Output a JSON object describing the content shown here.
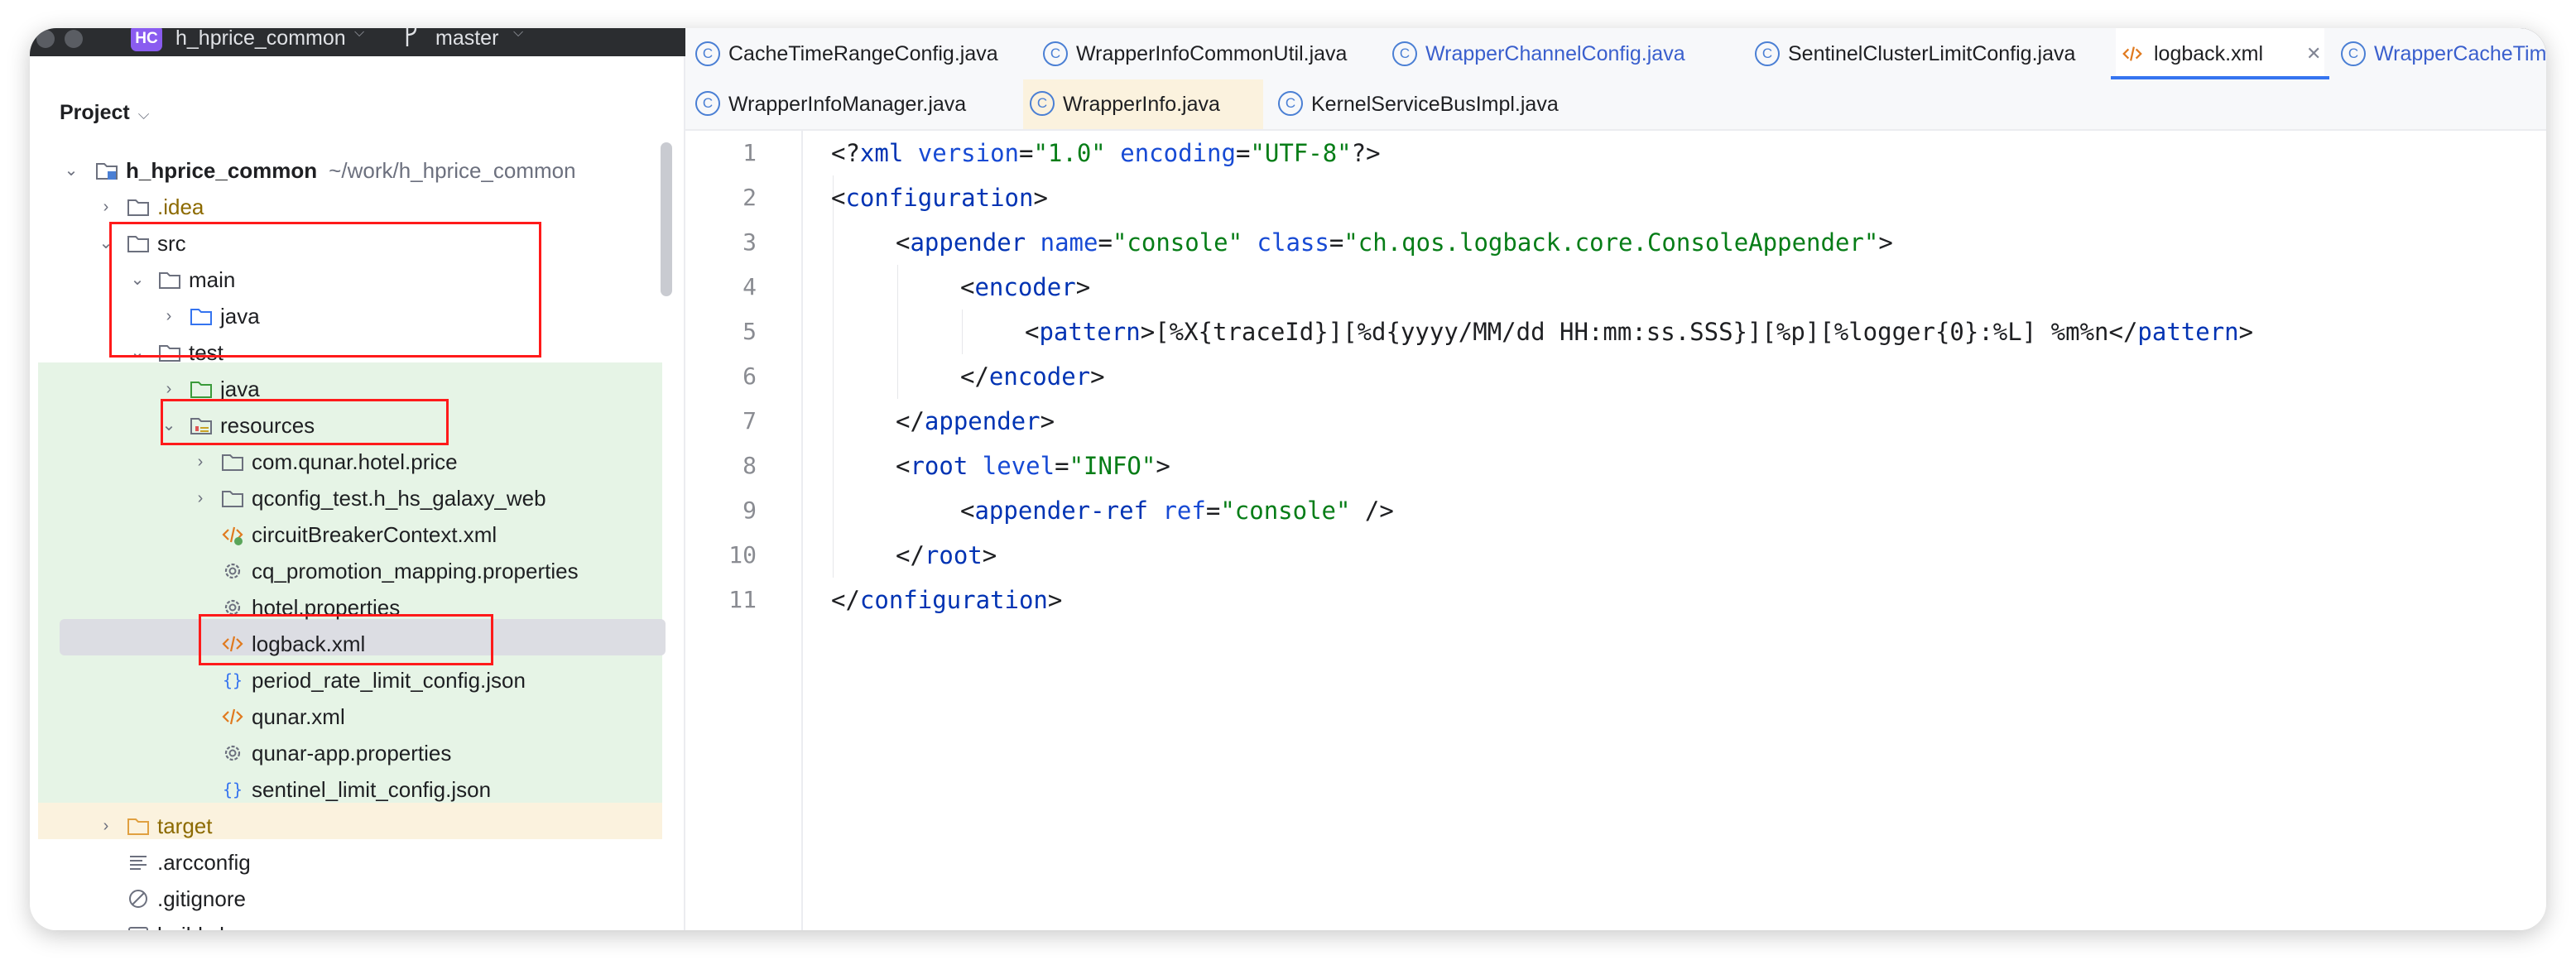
{
  "titlebar": {
    "project_badge": "HC",
    "project_name": "h_hprice_common",
    "branch": "master",
    "colors": {
      "bar": "#2b2d30",
      "badge": "#8a5cf0"
    }
  },
  "sidebar": {
    "title": "Project",
    "tree": [
      {
        "label": "h_hprice_common",
        "sub": "~/work/h_hprice_common",
        "icon": "module-folder-icon",
        "bold": true
      },
      {
        "label": ".idea",
        "icon": "folder-icon",
        "color": "#8c6a00"
      },
      {
        "label": "src",
        "icon": "folder-icon"
      },
      {
        "label": "main",
        "icon": "folder-icon"
      },
      {
        "label": "java",
        "icon": "source-folder-icon"
      },
      {
        "label": "test",
        "icon": "folder-icon"
      },
      {
        "label": "java",
        "icon": "test-folder-icon"
      },
      {
        "label": "resources",
        "icon": "resources-folder-icon"
      },
      {
        "label": "com.qunar.hotel.price",
        "icon": "package-folder-icon"
      },
      {
        "label": "qconfig_test.h_hs_galaxy_web",
        "icon": "package-folder-icon"
      },
      {
        "label": "circuitBreakerContext.xml",
        "icon": "xml-file-icon"
      },
      {
        "label": "cq_promotion_mapping.properties",
        "icon": "properties-file-icon"
      },
      {
        "label": "hotel.properties",
        "icon": "properties-file-icon"
      },
      {
        "label": "logback.xml",
        "icon": "xml-file-icon"
      },
      {
        "label": "period_rate_limit_config.json",
        "icon": "json-file-icon"
      },
      {
        "label": "qunar.xml",
        "icon": "xml-file-icon"
      },
      {
        "label": "qunar-app.properties",
        "icon": "properties-file-icon"
      },
      {
        "label": "sentinel_limit_config.json",
        "icon": "json-file-icon"
      },
      {
        "label": "target",
        "icon": "excluded-folder-icon",
        "color": "#8c6a00"
      },
      {
        "label": ".arcconfig",
        "icon": "text-file-icon"
      },
      {
        "label": ".gitignore",
        "icon": "ignore-file-icon"
      },
      {
        "label": "build.sh",
        "icon": "shell-file-icon"
      }
    ]
  },
  "tabs_row1": [
    {
      "label": "CacheTimeRangeConfig.java",
      "icon": "class-icon",
      "color": "#1e1f22"
    },
    {
      "label": "WrapperInfoCommonUtil.java",
      "icon": "class-icon",
      "color": "#1e1f22"
    },
    {
      "label": "WrapperChannelConfig.java",
      "icon": "class-icon",
      "color": "#3a5fcd"
    },
    {
      "label": "SentinelClusterLimitConfig.java",
      "icon": "class-icon",
      "color": "#1e1f22"
    },
    {
      "label": "logback.xml",
      "icon": "xml-file-icon",
      "color": "#1e1f22",
      "active": true,
      "close": "✕"
    },
    {
      "label": "WrapperCacheTimeConf",
      "icon": "class-icon",
      "color": "#3a5fcd"
    }
  ],
  "tabs_row2": [
    {
      "label": "WrapperInfoManager.java",
      "icon": "class-icon",
      "color": "#1e1f22"
    },
    {
      "label": "WrapperInfo.java",
      "icon": "class-icon",
      "color": "#1e1f22"
    },
    {
      "label": "KernelServiceBusImpl.java",
      "icon": "class-icon",
      "color": "#1e1f22"
    }
  ],
  "editor": {
    "lines": [
      "1",
      "2",
      "3",
      "4",
      "5",
      "6",
      "7",
      "8",
      "9",
      "10",
      "11"
    ],
    "code": {
      "l1": {
        "open": "<?",
        "name": "xml",
        "a1": "version",
        "v1": "\"1.0\"",
        "a2": "encoding",
        "v2": "\"UTF-8\"",
        "close": "?>"
      },
      "l2": {
        "name": "configuration"
      },
      "l3": {
        "name": "appender",
        "a1": "name",
        "v1": "\"console\"",
        "a2": "class",
        "v2": "\"ch.qos.logback.core.ConsoleAppender\""
      },
      "l4": {
        "name": "encoder"
      },
      "l5": {
        "name": "pattern",
        "text": "[%X{traceId}][%d{yyyy/MM/dd HH:mm:ss.SSS}][%p][%logger{0}:%L] %m%n"
      },
      "l6": {
        "name": "encoder"
      },
      "l7": {
        "name": "appender"
      },
      "l8": {
        "name": "root",
        "a1": "level",
        "v1": "\"INFO\""
      },
      "l9": {
        "name": "appender-ref",
        "a1": "ref",
        "v1": "\"console\"",
        "close": "/>"
      },
      "l10": {
        "name": "root"
      },
      "l11": {
        "name": "configuration"
      }
    }
  }
}
